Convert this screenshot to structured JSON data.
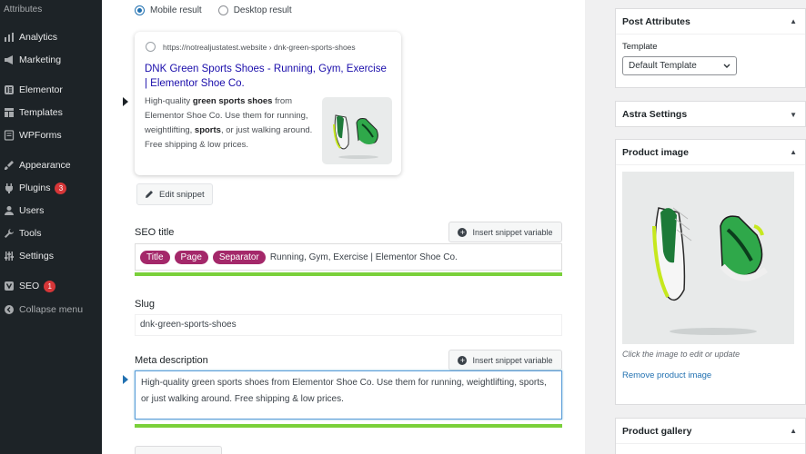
{
  "sidebar": {
    "top_label": "Attributes",
    "items": [
      {
        "label": "Analytics",
        "icon": "analytics-icon"
      },
      {
        "label": "Marketing",
        "icon": "marketing-icon"
      },
      {
        "label": "Elementor",
        "icon": "elementor-icon"
      },
      {
        "label": "Templates",
        "icon": "templates-icon"
      },
      {
        "label": "WPForms",
        "icon": "wpforms-icon"
      },
      {
        "label": "Appearance",
        "icon": "appearance-icon"
      },
      {
        "label": "Plugins",
        "icon": "plugins-icon",
        "badge": "3"
      },
      {
        "label": "Users",
        "icon": "users-icon"
      },
      {
        "label": "Tools",
        "icon": "tools-icon"
      },
      {
        "label": "Settings",
        "icon": "settings-icon"
      },
      {
        "label": "SEO",
        "icon": "yoast-icon",
        "badge": "1"
      },
      {
        "label": "Collapse menu",
        "icon": "collapse-icon"
      }
    ]
  },
  "preview": {
    "mobile_label": "Mobile result",
    "desktop_label": "Desktop result",
    "selected": "mobile",
    "url": "https://notrealjustatest.website › dnk-green-sports-shoes",
    "title": "DNK Green Sports Shoes - Running, Gym, Exercise | Elementor Shoe Co.",
    "desc_parts": [
      {
        "text": "High-quality ",
        "bold": false
      },
      {
        "text": "green sports shoes",
        "bold": true
      },
      {
        "text": " from Elementor Shoe Co. Use them for running, weightlifting, ",
        "bold": false
      },
      {
        "text": "sports",
        "bold": true
      },
      {
        "text": ", or just walking around. Free shipping & low prices.",
        "bold": false
      }
    ],
    "edit_snippet_label": "Edit snippet"
  },
  "seo_title": {
    "label": "SEO title",
    "insert_label": "Insert snippet variable",
    "pills": [
      "Title",
      "Page",
      "Separator"
    ],
    "text": "Running, Gym, Exercise | Elementor Shoe Co.",
    "progress": 1.0
  },
  "slug": {
    "label": "Slug",
    "value": "dnk-green-sports-shoes"
  },
  "meta_description": {
    "label": "Meta description",
    "insert_label": "Insert snippet variable",
    "value": "High-quality green sports shoes from Elementor Shoe Co. Use them for running, weightlifting, sports, or just walking around. Free shipping & low prices.",
    "progress": 1.0
  },
  "post_attributes": {
    "title": "Post Attributes",
    "template_label": "Template",
    "template_value": "Default Template"
  },
  "astra_settings": {
    "title": "Astra Settings"
  },
  "product_image": {
    "title": "Product image",
    "hint": "Click the image to edit or update",
    "remove_label": "Remove product image"
  },
  "product_gallery": {
    "title": "Product gallery"
  },
  "colors": {
    "admin_sidebar": "#1d2327",
    "link": "#2271b1",
    "serp_title": "#1a0dab",
    "pill": "#a4286a",
    "progress_good": "#7ad03a",
    "badge": "#d63638"
  }
}
